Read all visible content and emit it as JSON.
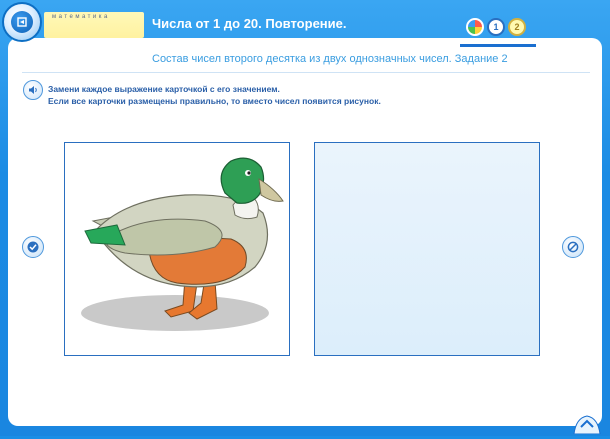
{
  "header": {
    "subject": "Математика",
    "lesson_title": "Числа от 1 до 20. Повторение.",
    "badges": [
      "1",
      "2"
    ]
  },
  "task": {
    "title": "Состав чисел второго десятка из двух однозначных чисел. Задание 2",
    "instruction_line1": "Замени каждое выражение карточкой с его значением.",
    "instruction_line2": "Если все карточки размещены правильно, то вместо чисел появится рисунок."
  },
  "icons": {
    "home": "home-icon",
    "sound": "speaker-icon",
    "check": "check-icon",
    "cancel": "no-icon",
    "scroll_up": "chevron-up-icon"
  },
  "colors": {
    "frame": "#1a8ee6",
    "accent": "#2a6fc0",
    "title": "#3a9de0"
  }
}
